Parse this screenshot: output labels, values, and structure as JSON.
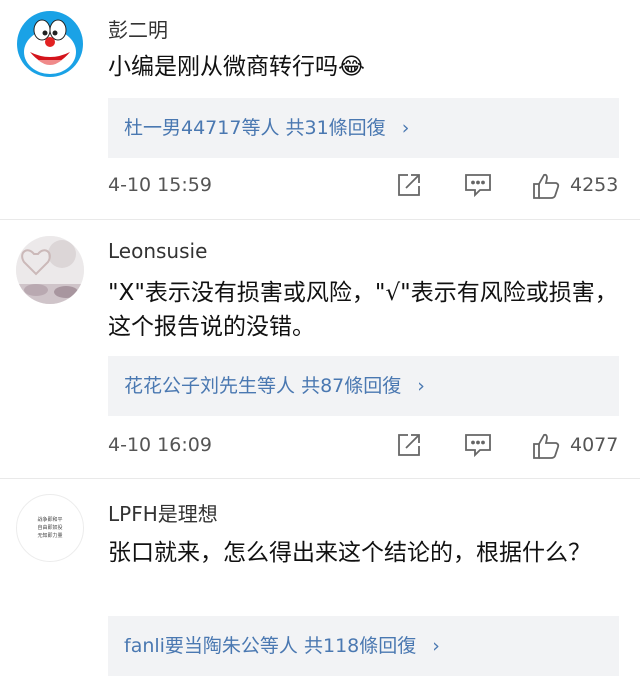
{
  "comments": [
    {
      "username": "彭二明",
      "text": "小编是刚从微商转行吗😂",
      "replies_people": "杜一男44717等人",
      "replies_total": "共31條回復",
      "timestamp": "4-10 15:59",
      "likes": "4253",
      "avatar_icon": "doraemon-avatar-icon"
    },
    {
      "username": "Leonsusie",
      "text": "\"X\"表示没有损害或风险，\"√\"表示有风险或损害，这个报告说的没错。",
      "replies_people": "花花公子刘先生等人",
      "replies_total": "共87條回復",
      "timestamp": "4-10 16:09",
      "likes": "4077",
      "avatar_icon": "heart-photo-avatar-icon"
    },
    {
      "username": "LPFH是理想",
      "text": "张口就来，怎么得出来这个结论的，根据什么？",
      "replies_people": "fanli要当陶朱公等人",
      "replies_total": "共118條回復",
      "avatar_icon": "text-logo-avatar-icon",
      "avatar_lines": [
        "战争即和平",
        "自由即奴役",
        "无知即力量"
      ]
    }
  ],
  "chevron": "›",
  "colors": {
    "reply_link": "#4a78b1",
    "reply_bg": "#f2f3f5",
    "meta_text": "#555555"
  }
}
